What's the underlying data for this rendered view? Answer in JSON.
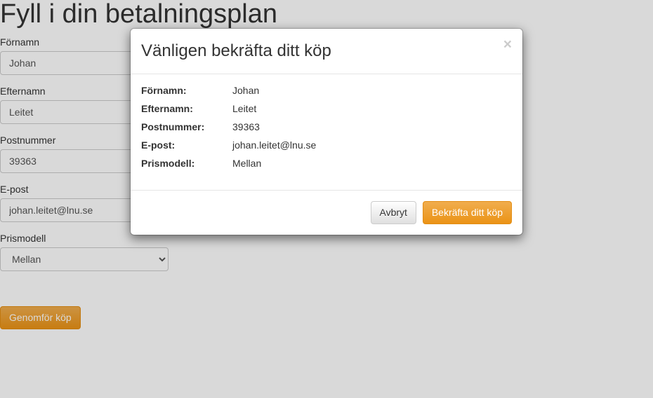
{
  "page": {
    "title": "Fyll i din betalningsplan"
  },
  "form": {
    "fornamn": {
      "label": "Förnamn",
      "value": "Johan"
    },
    "efternamn": {
      "label": "Efternamn",
      "value": "Leitet"
    },
    "postnummer": {
      "label": "Postnummer",
      "value": "39363"
    },
    "epost": {
      "label": "E-post",
      "value": "johan.leitet@lnu.se"
    },
    "prismodell": {
      "label": "Prismodell",
      "value": "Mellan"
    },
    "submit_label": "Genomför köp"
  },
  "modal": {
    "title": "Vänligen bekräfta ditt köp",
    "close_glyph": "×",
    "rows": {
      "fornamn": {
        "label": "Förnamn:",
        "value": "Johan"
      },
      "efternamn": {
        "label": "Efternamn:",
        "value": "Leitet"
      },
      "postnummer": {
        "label": "Postnummer:",
        "value": "39363"
      },
      "epost": {
        "label": "E-post:",
        "value": "johan.leitet@lnu.se"
      },
      "prismodell": {
        "label": "Prismodell:",
        "value": "Mellan"
      }
    },
    "cancel_label": "Avbryt",
    "confirm_label": "Bekräfta ditt köp"
  }
}
